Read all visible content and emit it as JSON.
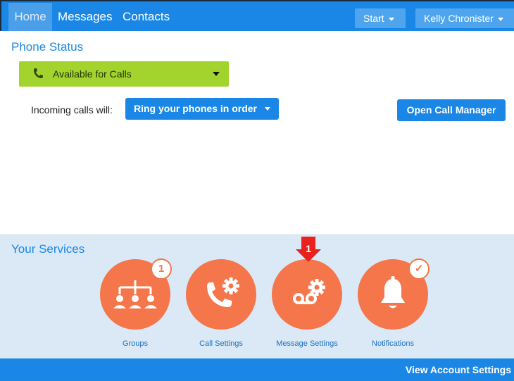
{
  "nav": {
    "home": "Home",
    "messages": "Messages",
    "contacts": "Contacts",
    "start": "Start",
    "user": "Kelly Chronister"
  },
  "phone_status": {
    "title": "Phone Status",
    "availability": "Available for Calls",
    "incoming_label": "Incoming calls will:",
    "incoming_option": "Ring your phones in order",
    "call_manager": "Open Call Manager"
  },
  "services": {
    "title": "Your Services",
    "items": [
      {
        "label": "Groups",
        "icon": "groups-icon",
        "badge": "1"
      },
      {
        "label": "Call Settings",
        "icon": "call-settings-icon",
        "badge": ""
      },
      {
        "label": "Message Settings",
        "icon": "message-settings-icon",
        "badge": ""
      },
      {
        "label": "Notifications",
        "icon": "bell-icon",
        "badge": "✓"
      }
    ],
    "arrow_callout": "1"
  },
  "footer": {
    "view_account_settings": "View Account Settings"
  },
  "colors": {
    "primary_blue": "#1a87e6",
    "available_green": "#a3d32d",
    "service_orange": "#f4764a",
    "services_bg": "#dbe9f6",
    "callout_red": "#e8221c"
  }
}
